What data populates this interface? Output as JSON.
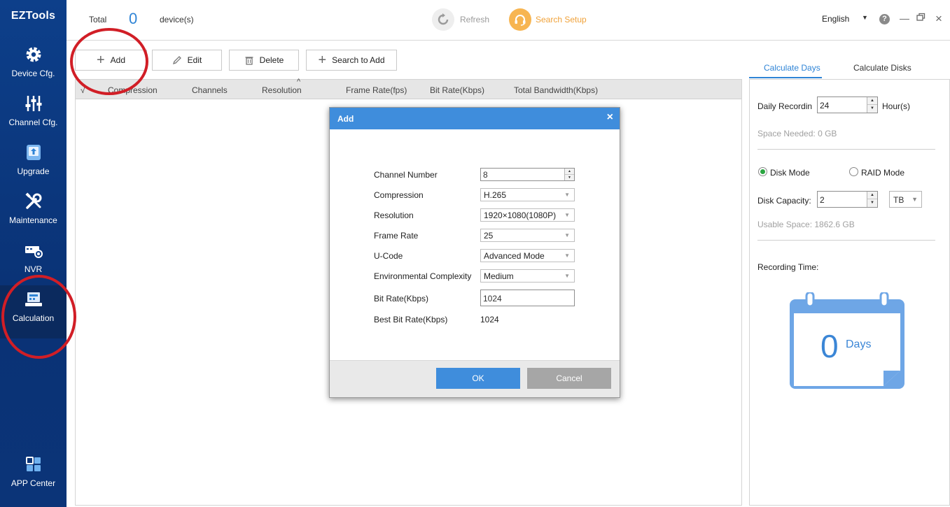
{
  "app": {
    "brand": "EZTools"
  },
  "sidebar": {
    "items": [
      {
        "label": "Device Cfg."
      },
      {
        "label": "Channel Cfg."
      },
      {
        "label": "Upgrade"
      },
      {
        "label": "Maintenance"
      },
      {
        "label": "NVR"
      },
      {
        "label": "Calculation"
      },
      {
        "label": "APP Center"
      }
    ]
  },
  "topbar": {
    "total_label": "Total",
    "device_count": "0",
    "device_suffix": "device(s)",
    "refresh_label": "Refresh",
    "search_setup_label": "Search Setup",
    "language": "English",
    "help": "?"
  },
  "toolbar": {
    "add": "Add",
    "edit": "Edit",
    "delete": "Delete",
    "search_to_add": "Search to Add"
  },
  "table": {
    "check_mark": "√",
    "columns": [
      "Compression",
      "Channels",
      "Resolution",
      "Frame Rate(fps)",
      "Bit Rate(Kbps)",
      "Total Bandwidth(Kbps)"
    ],
    "sort_glyph": "^"
  },
  "right_panel": {
    "tabs": [
      "Calculate Days",
      "Calculate Disks"
    ],
    "daily_recording_label": "Daily Recordin",
    "daily_recording_value": "24",
    "hours_unit": "Hour(s)",
    "space_needed": "Space Needed: 0 GB",
    "disk_mode": "Disk Mode",
    "raid_mode": "RAID Mode",
    "disk_capacity_label": "Disk Capacity:",
    "disk_capacity_value": "2",
    "disk_unit": "TB",
    "usable_space": "Usable Space: 1862.6 GB",
    "recording_time_label": "Recording Time:",
    "days_value": "0",
    "days_unit": "Days"
  },
  "modal": {
    "title": "Add",
    "close": "×",
    "fields": {
      "channel_number_label": "Channel Number",
      "channel_number_value": "8",
      "compression_label": "Compression",
      "compression_value": "H.265",
      "resolution_label": "Resolution",
      "resolution_value": "1920×1080(1080P)",
      "frame_rate_label": "Frame Rate",
      "frame_rate_value": "25",
      "ucode_label": "U-Code",
      "ucode_value": "Advanced Mode",
      "env_label": "Environmental Complexity",
      "env_value": "Medium",
      "bitrate_label": "Bit Rate(Kbps)",
      "bitrate_value": "1024",
      "best_bitrate_label": "Best Bit Rate(Kbps)",
      "best_bitrate_value": "1024"
    },
    "ok": "OK",
    "cancel": "Cancel"
  },
  "colors": {
    "accent": "#3f8ddc",
    "sidebar": "#0d3f8a",
    "annotation": "#d11e26",
    "search_setup": "#f0a23a"
  }
}
